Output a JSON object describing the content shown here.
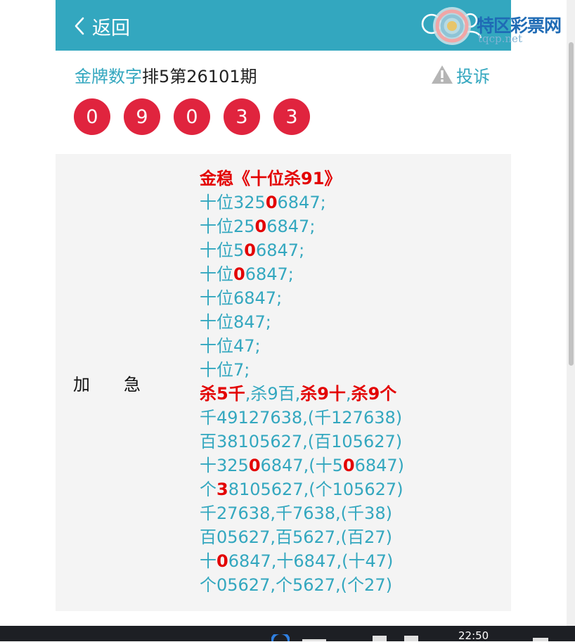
{
  "header": {
    "back_label": "返回"
  },
  "watermark": {
    "site_name": "特区彩票网",
    "site_url": "tqcp.net"
  },
  "post": {
    "author": "金牌数字",
    "title": "排5第26101期",
    "complain_label": "投诉",
    "numbers": [
      "0",
      "9",
      "0",
      "3",
      "3"
    ]
  },
  "panel": {
    "tag_part1": "加",
    "tag_part2": "急",
    "lines": [
      [
        {
          "t": "金稳《十位杀91》",
          "red": true
        }
      ],
      [
        {
          "t": "十位325"
        },
        {
          "t": "0",
          "red": true
        },
        {
          "t": "6847;"
        }
      ],
      [
        {
          "t": "十位25"
        },
        {
          "t": "0",
          "red": true
        },
        {
          "t": "6847;"
        }
      ],
      [
        {
          "t": "十位5"
        },
        {
          "t": "0",
          "red": true
        },
        {
          "t": "6847;"
        }
      ],
      [
        {
          "t": "十位"
        },
        {
          "t": "0",
          "red": true
        },
        {
          "t": "6847;"
        }
      ],
      [
        {
          "t": "十位6847;"
        }
      ],
      [
        {
          "t": "十位847;"
        }
      ],
      [
        {
          "t": "十位47;"
        }
      ],
      [
        {
          "t": "十位7;"
        }
      ],
      [
        {
          "t": "杀5千",
          "red": true
        },
        {
          "t": ",杀9百,"
        },
        {
          "t": "杀9十",
          "red": true
        },
        {
          "t": ","
        },
        {
          "t": "杀9个",
          "red": true
        }
      ],
      [
        {
          "t": "千49127638,(千127638)"
        }
      ],
      [
        {
          "t": "百38105627,(百105627)"
        }
      ],
      [
        {
          "t": "十325"
        },
        {
          "t": "0",
          "red": true
        },
        {
          "t": "6847,(十5"
        },
        {
          "t": "0",
          "red": true
        },
        {
          "t": "6847)"
        }
      ],
      [
        {
          "t": "个"
        },
        {
          "t": "3",
          "red": true
        },
        {
          "t": "8105627,(个105627)"
        }
      ],
      [
        {
          "t": "千27638,千7638,(千38)"
        }
      ],
      [
        {
          "t": "百05627,百5627,(百27)"
        }
      ],
      [
        {
          "t": "十"
        },
        {
          "t": "0",
          "red": true
        },
        {
          "t": "6847,十6847,(十47)"
        }
      ],
      [
        {
          "t": "个05627,个5627,(个27)"
        }
      ]
    ]
  },
  "taskbar": {
    "time": "22:50"
  },
  "colors": {
    "accent": "#33a7bf",
    "ball": "#e0243e",
    "highlight": "#e30000",
    "panel_bg": "#f4f4f4"
  }
}
